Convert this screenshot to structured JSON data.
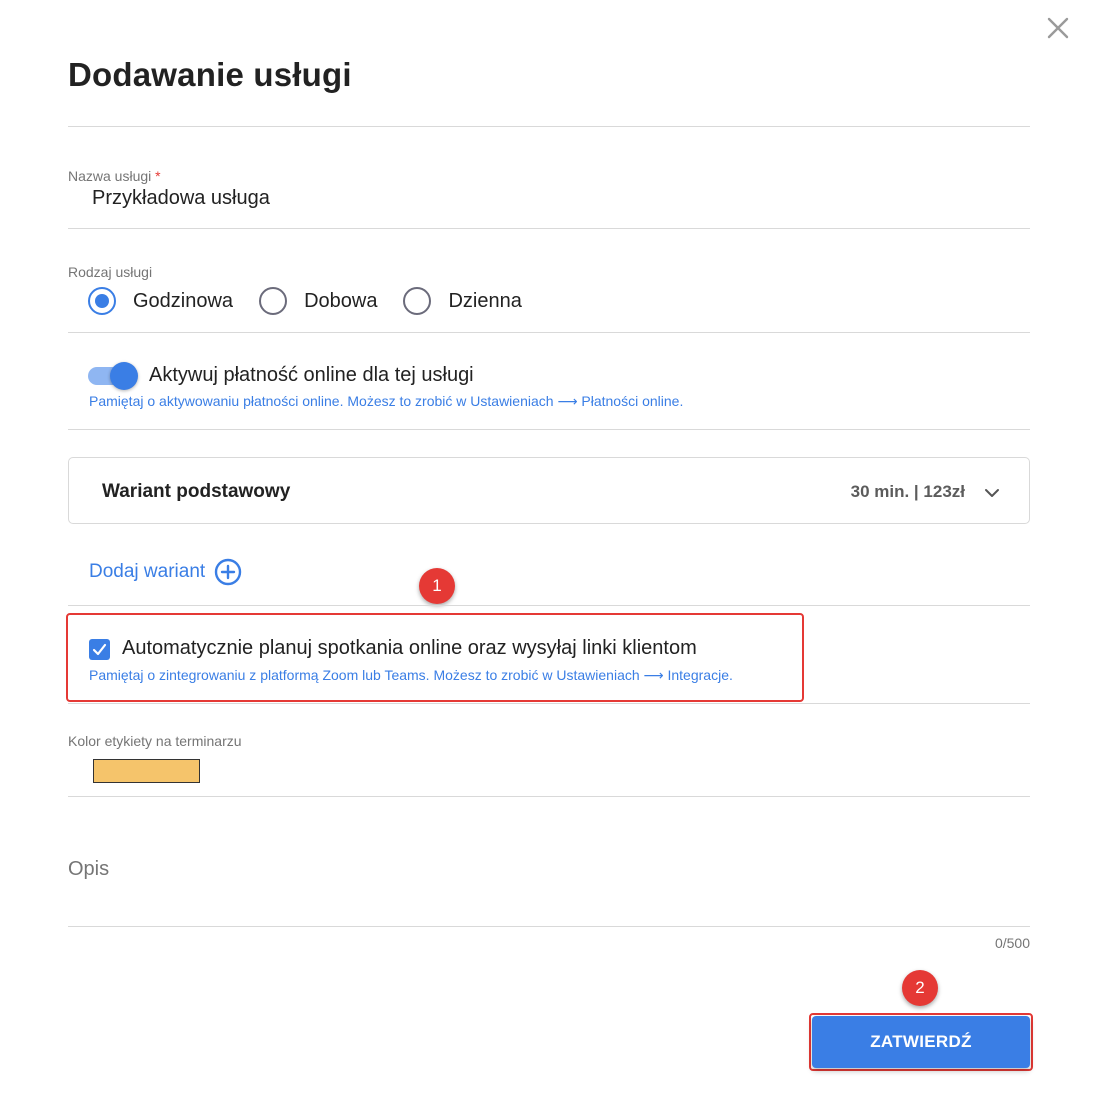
{
  "dialog": {
    "title": "Dodawanie usługi",
    "close_icon": "close-icon"
  },
  "service_name": {
    "label": "Nazwa usługi",
    "required_mark": "*",
    "value": "Przykładowa usługa"
  },
  "service_type": {
    "label": "Rodzaj usługi",
    "options": [
      {
        "label": "Godzinowa",
        "selected": true
      },
      {
        "label": "Dobowa",
        "selected": false
      },
      {
        "label": "Dzienna",
        "selected": false
      }
    ]
  },
  "online_payment": {
    "label": "Aktywuj płatność online dla tej usługi",
    "enabled": true,
    "hint": "Pamiętaj o aktywowaniu płatności online. Możesz to zrobić w Ustawieniach ⟶ Płatności online."
  },
  "variant": {
    "name": "Wariant podstawowy",
    "meta": "30 min. | 123zł",
    "expand_icon": "chevron-down-icon"
  },
  "add_variant": {
    "label": "Dodaj wariant",
    "icon": "plus-circle-icon"
  },
  "auto_meetings": {
    "label": "Automatycznie planuj spotkania online oraz wysyłaj linki klientom",
    "checked": true,
    "hint": "Pamiętaj o zintegrowaniu z platformą Zoom lub Teams. Możesz to zrobić w Ustawieniach ⟶ Integracje."
  },
  "label_color": {
    "label": "Kolor etykiety na terminarzu",
    "value": "#f5c46b"
  },
  "description": {
    "placeholder": "Opis",
    "counter": "0/500"
  },
  "submit_label": "ZATWIERDŹ",
  "markers": [
    "1",
    "2"
  ],
  "colors": {
    "accent": "#3a7ee5",
    "highlight": "#e53935"
  }
}
